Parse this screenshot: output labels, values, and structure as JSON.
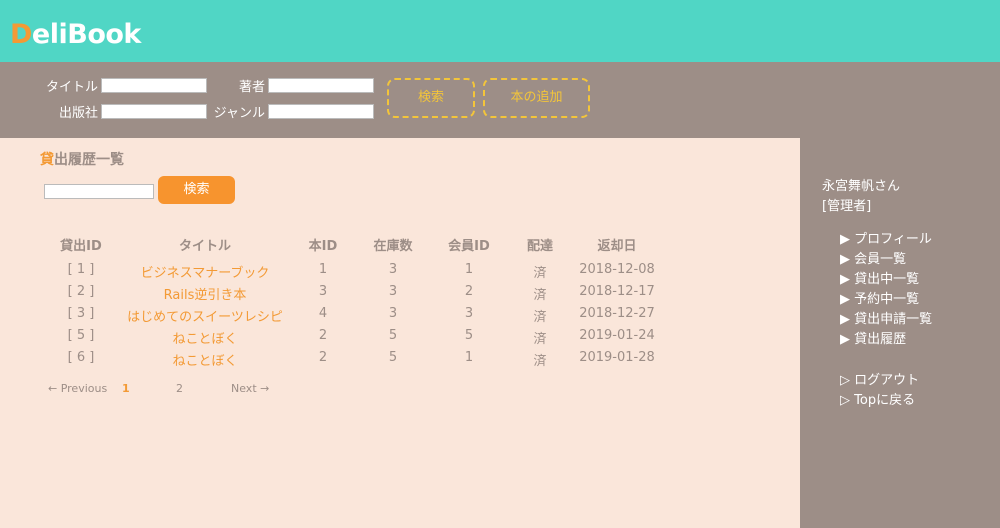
{
  "header": {
    "logo_first": "D",
    "logo_rest": "eliBook"
  },
  "search": {
    "title_label": "タイトル",
    "author_label": "著者",
    "publisher_label": "出版社",
    "genre_label": "ジャンル",
    "search_button": "検索",
    "add_book_button": "本の追加"
  },
  "main": {
    "title_accent": "貸",
    "title_rest": "出履歴一覧",
    "search_button": "検索",
    "columns": [
      "貸出ID",
      "タイトル",
      "本ID",
      "在庫数",
      "会員ID",
      "配達",
      "返却日"
    ],
    "rows": [
      [
        "[ 1 ]",
        "ビジネスマナーブック",
        "1",
        "3",
        "1",
        "済",
        "2018-12-08"
      ],
      [
        "[ 2 ]",
        "Rails逆引き本",
        "3",
        "3",
        "2",
        "済",
        "2018-12-17"
      ],
      [
        "[ 3 ]",
        "はじめてのスイーツレシピ",
        "4",
        "3",
        "3",
        "済",
        "2018-12-27"
      ],
      [
        "[ 5 ]",
        "ねことぼく",
        "2",
        "5",
        "5",
        "済",
        "2019-01-24"
      ],
      [
        "[ 6 ]",
        "ねことぼく",
        "2",
        "5",
        "1",
        "済",
        "2019-01-28"
      ]
    ],
    "pagination": {
      "previous": "←   Previous",
      "page1": "1",
      "page2": "2",
      "next": "Next   →"
    }
  },
  "sidebar": {
    "user_name": "永宮舞帆さん",
    "role": "[管理者]",
    "menu": [
      "▶ プロフィール",
      "▶ 会員一覧",
      "▶ 貸出中一覧",
      "▶ 予約中一覧",
      "▶ 貸出申請一覧",
      "▶ 貸出履歴"
    ],
    "logout": "▷ ログアウト",
    "top": "▷ Topに戻る"
  },
  "colors": {
    "header": "#50d6c5",
    "bar": "#9d8e87",
    "accent": "#f39a35",
    "background": "#fae6da",
    "button_dashed": "#f3c53a"
  }
}
